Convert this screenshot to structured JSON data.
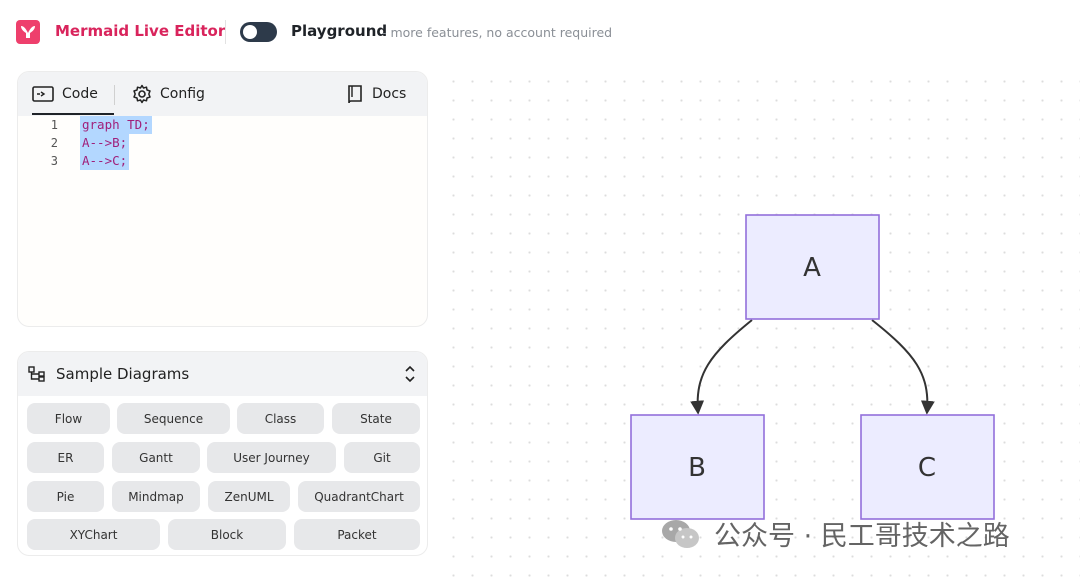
{
  "header": {
    "app_title": "Mermaid Live Editor",
    "playground_label": "Playground",
    "playground_subtitle": "- more features, no account required",
    "playground_enabled": false
  },
  "editor": {
    "tabs": [
      {
        "label": "Code",
        "icon": "code-icon",
        "active": true
      },
      {
        "label": "Config",
        "icon": "gear-icon",
        "active": false
      },
      {
        "label": "Docs",
        "icon": "book-icon",
        "active": false
      }
    ],
    "lines": [
      {
        "number": "1",
        "text": "graph TD;"
      },
      {
        "number": "2",
        "text": "A-->B;"
      },
      {
        "number": "3",
        "text": "A-->C;"
      }
    ]
  },
  "samples": {
    "title": "Sample Diagrams",
    "items": [
      "Flow",
      "Sequence",
      "Class",
      "State",
      "ER",
      "Gantt",
      "User Journey",
      "Git",
      "Pie",
      "Mindmap",
      "ZenUML",
      "QuadrantChart",
      "XYChart",
      "Block",
      "Packet"
    ]
  },
  "diagram": {
    "nodes": [
      "A",
      "B",
      "C"
    ],
    "edges": [
      [
        "A",
        "B"
      ],
      [
        "A",
        "C"
      ]
    ],
    "node_fill": "#ececff",
    "node_stroke": "#9370db"
  },
  "watermark": {
    "text": "公众号 · 民工哥技术之路"
  },
  "colors": {
    "brand": "#ee3f6c",
    "title": "#d9245c",
    "selection": "#b3d7ff"
  }
}
